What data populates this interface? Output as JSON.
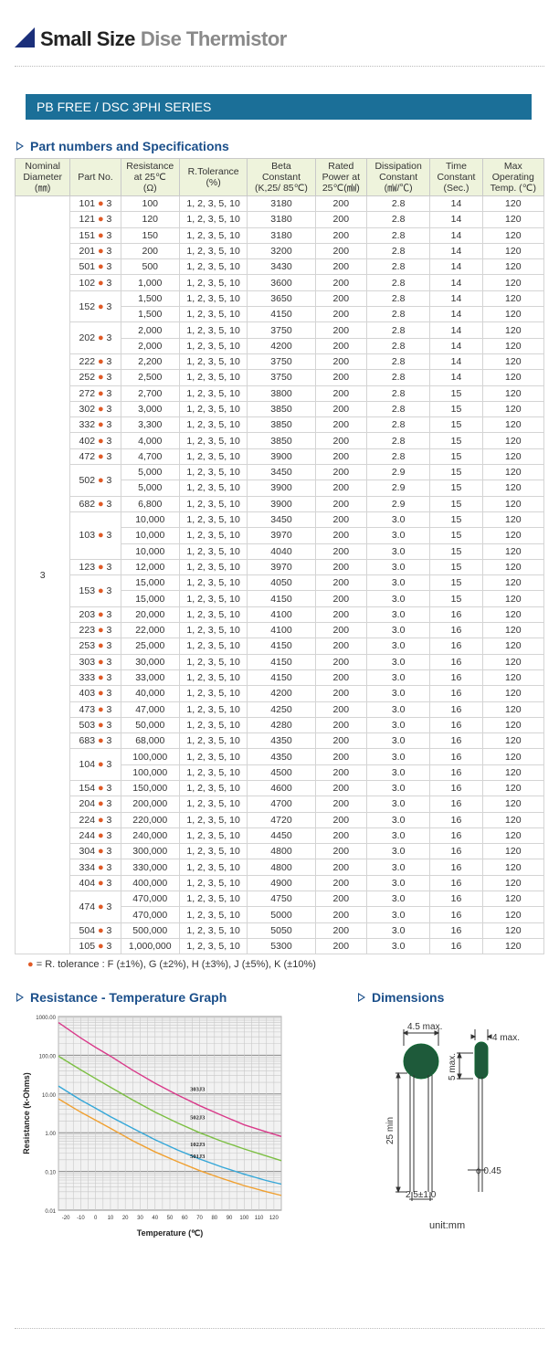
{
  "title": {
    "bold": "Small Size",
    "rest": "Dise Thermistor"
  },
  "series_label": "PB FREE  /  DSC 3PHI SERIES",
  "section_specs": "Part numbers and Specifications",
  "table": {
    "headers": [
      {
        "line1": "Nominal",
        "line2": "Diameter",
        "line3": "(㎜)"
      },
      {
        "line1": "Part No.",
        "line2": "",
        "line3": ""
      },
      {
        "line1": "Resistance",
        "line2": "at 25℃",
        "line3": "(Ω)"
      },
      {
        "line1": "R.Tolerance",
        "line2": "(%)",
        "line3": ""
      },
      {
        "line1": "Beta",
        "line2": "Constant",
        "line3": "(K,25/ 85℃)"
      },
      {
        "line1": "Rated",
        "line2": "Power at",
        "line3": "25℃(㎽)"
      },
      {
        "line1": "Dissipation",
        "line2": "Constant",
        "line3": "(㎽/℃)"
      },
      {
        "line1": "Time",
        "line2": "Constant",
        "line3": "(Sec.)"
      },
      {
        "line1": "Max",
        "line2": "Operating",
        "line3": "Temp. (℃)"
      }
    ],
    "diameter": "3",
    "dot": "●",
    "groups": [
      {
        "part": "101",
        "suffix": "3",
        "rows": [
          [
            "100",
            "1, 2, 3, 5, 10",
            "3180",
            "200",
            "2.8",
            "14",
            "120"
          ]
        ]
      },
      {
        "part": "121",
        "suffix": "3",
        "rows": [
          [
            "120",
            "1, 2, 3, 5, 10",
            "3180",
            "200",
            "2.8",
            "14",
            "120"
          ]
        ]
      },
      {
        "part": "151",
        "suffix": "3",
        "rows": [
          [
            "150",
            "1, 2, 3, 5, 10",
            "3180",
            "200",
            "2.8",
            "14",
            "120"
          ]
        ]
      },
      {
        "part": "201",
        "suffix": "3",
        "rows": [
          [
            "200",
            "1, 2, 3, 5, 10",
            "3200",
            "200",
            "2.8",
            "14",
            "120"
          ]
        ]
      },
      {
        "part": "501",
        "suffix": "3",
        "rows": [
          [
            "500",
            "1, 2, 3, 5, 10",
            "3430",
            "200",
            "2.8",
            "14",
            "120"
          ]
        ]
      },
      {
        "part": "102",
        "suffix": "3",
        "rows": [
          [
            "1,000",
            "1, 2, 3, 5, 10",
            "3600",
            "200",
            "2.8",
            "14",
            "120"
          ]
        ]
      },
      {
        "part": "152",
        "suffix": "3",
        "rows": [
          [
            "1,500",
            "1, 2, 3, 5, 10",
            "3650",
            "200",
            "2.8",
            "14",
            "120"
          ],
          [
            "1,500",
            "1, 2, 3, 5, 10",
            "4150",
            "200",
            "2.8",
            "14",
            "120"
          ]
        ]
      },
      {
        "part": "202",
        "suffix": "3",
        "rows": [
          [
            "2,000",
            "1, 2, 3, 5, 10",
            "3750",
            "200",
            "2.8",
            "14",
            "120"
          ],
          [
            "2,000",
            "1, 2, 3, 5, 10",
            "4200",
            "200",
            "2.8",
            "14",
            "120"
          ]
        ]
      },
      {
        "part": "222",
        "suffix": "3",
        "rows": [
          [
            "2,200",
            "1, 2, 3, 5, 10",
            "3750",
            "200",
            "2.8",
            "14",
            "120"
          ]
        ]
      },
      {
        "part": "252",
        "suffix": "3",
        "rows": [
          [
            "2,500",
            "1, 2, 3, 5, 10",
            "3750",
            "200",
            "2.8",
            "14",
            "120"
          ]
        ]
      },
      {
        "part": "272",
        "suffix": "3",
        "rows": [
          [
            "2,700",
            "1, 2, 3, 5, 10",
            "3800",
            "200",
            "2.8",
            "15",
            "120"
          ]
        ]
      },
      {
        "part": "302",
        "suffix": "3",
        "rows": [
          [
            "3,000",
            "1, 2, 3, 5, 10",
            "3850",
            "200",
            "2.8",
            "15",
            "120"
          ]
        ]
      },
      {
        "part": "332",
        "suffix": "3",
        "rows": [
          [
            "3,300",
            "1, 2, 3, 5, 10",
            "3850",
            "200",
            "2.8",
            "15",
            "120"
          ]
        ]
      },
      {
        "part": "402",
        "suffix": "3",
        "rows": [
          [
            "4,000",
            "1, 2, 3, 5, 10",
            "3850",
            "200",
            "2.8",
            "15",
            "120"
          ]
        ]
      },
      {
        "part": "472",
        "suffix": "3",
        "rows": [
          [
            "4,700",
            "1, 2, 3, 5, 10",
            "3900",
            "200",
            "2.8",
            "15",
            "120"
          ]
        ]
      },
      {
        "part": "502",
        "suffix": "3",
        "rows": [
          [
            "5,000",
            "1, 2, 3, 5, 10",
            "3450",
            "200",
            "2.9",
            "15",
            "120"
          ],
          [
            "5,000",
            "1, 2, 3, 5, 10",
            "3900",
            "200",
            "2.9",
            "15",
            "120"
          ]
        ]
      },
      {
        "part": "682",
        "suffix": "3",
        "rows": [
          [
            "6,800",
            "1, 2, 3, 5, 10",
            "3900",
            "200",
            "2.9",
            "15",
            "120"
          ]
        ]
      },
      {
        "part": "103",
        "suffix": "3",
        "rows": [
          [
            "10,000",
            "1, 2, 3, 5, 10",
            "3450",
            "200",
            "3.0",
            "15",
            "120"
          ],
          [
            "10,000",
            "1, 2, 3, 5, 10",
            "3970",
            "200",
            "3.0",
            "15",
            "120"
          ],
          [
            "10,000",
            "1, 2, 3, 5, 10",
            "4040",
            "200",
            "3.0",
            "15",
            "120"
          ]
        ]
      },
      {
        "part": "123",
        "suffix": "3",
        "rows": [
          [
            "12,000",
            "1, 2, 3, 5, 10",
            "3970",
            "200",
            "3.0",
            "15",
            "120"
          ]
        ]
      },
      {
        "part": "153",
        "suffix": "3",
        "rows": [
          [
            "15,000",
            "1, 2, 3, 5, 10",
            "4050",
            "200",
            "3.0",
            "15",
            "120"
          ],
          [
            "15,000",
            "1, 2, 3, 5, 10",
            "4150",
            "200",
            "3.0",
            "15",
            "120"
          ]
        ]
      },
      {
        "part": "203",
        "suffix": "3",
        "rows": [
          [
            "20,000",
            "1, 2, 3, 5, 10",
            "4100",
            "200",
            "3.0",
            "16",
            "120"
          ]
        ]
      },
      {
        "part": "223",
        "suffix": "3",
        "rows": [
          [
            "22,000",
            "1, 2, 3, 5, 10",
            "4100",
            "200",
            "3.0",
            "16",
            "120"
          ]
        ]
      },
      {
        "part": "253",
        "suffix": "3",
        "rows": [
          [
            "25,000",
            "1, 2, 3, 5, 10",
            "4150",
            "200",
            "3.0",
            "16",
            "120"
          ]
        ]
      },
      {
        "part": "303",
        "suffix": "3",
        "rows": [
          [
            "30,000",
            "1, 2, 3, 5, 10",
            "4150",
            "200",
            "3.0",
            "16",
            "120"
          ]
        ]
      },
      {
        "part": "333",
        "suffix": "3",
        "rows": [
          [
            "33,000",
            "1, 2, 3, 5, 10",
            "4150",
            "200",
            "3.0",
            "16",
            "120"
          ]
        ]
      },
      {
        "part": "403",
        "suffix": "3",
        "rows": [
          [
            "40,000",
            "1, 2, 3, 5, 10",
            "4200",
            "200",
            "3.0",
            "16",
            "120"
          ]
        ]
      },
      {
        "part": "473",
        "suffix": "3",
        "rows": [
          [
            "47,000",
            "1, 2, 3, 5, 10",
            "4250",
            "200",
            "3.0",
            "16",
            "120"
          ]
        ]
      },
      {
        "part": "503",
        "suffix": "3",
        "rows": [
          [
            "50,000",
            "1, 2, 3, 5, 10",
            "4280",
            "200",
            "3.0",
            "16",
            "120"
          ]
        ]
      },
      {
        "part": "683",
        "suffix": "3",
        "rows": [
          [
            "68,000",
            "1, 2, 3, 5, 10",
            "4350",
            "200",
            "3.0",
            "16",
            "120"
          ]
        ]
      },
      {
        "part": "104",
        "suffix": "3",
        "rows": [
          [
            "100,000",
            "1, 2, 3, 5, 10",
            "4350",
            "200",
            "3.0",
            "16",
            "120"
          ],
          [
            "100,000",
            "1, 2, 3, 5, 10",
            "4500",
            "200",
            "3.0",
            "16",
            "120"
          ]
        ]
      },
      {
        "part": "154",
        "suffix": "3",
        "rows": [
          [
            "150,000",
            "1, 2, 3, 5, 10",
            "4600",
            "200",
            "3.0",
            "16",
            "120"
          ]
        ]
      },
      {
        "part": "204",
        "suffix": "3",
        "rows": [
          [
            "200,000",
            "1, 2, 3, 5, 10",
            "4700",
            "200",
            "3.0",
            "16",
            "120"
          ]
        ]
      },
      {
        "part": "224",
        "suffix": "3",
        "rows": [
          [
            "220,000",
            "1, 2, 3, 5, 10",
            "4720",
            "200",
            "3.0",
            "16",
            "120"
          ]
        ]
      },
      {
        "part": "244",
        "suffix": "3",
        "rows": [
          [
            "240,000",
            "1, 2, 3, 5, 10",
            "4450",
            "200",
            "3.0",
            "16",
            "120"
          ]
        ]
      },
      {
        "part": "304",
        "suffix": "3",
        "rows": [
          [
            "300,000",
            "1, 2, 3, 5, 10",
            "4800",
            "200",
            "3.0",
            "16",
            "120"
          ]
        ]
      },
      {
        "part": "334",
        "suffix": "3",
        "rows": [
          [
            "330,000",
            "1, 2, 3, 5, 10",
            "4800",
            "200",
            "3.0",
            "16",
            "120"
          ]
        ]
      },
      {
        "part": "404",
        "suffix": "3",
        "rows": [
          [
            "400,000",
            "1, 2, 3, 5, 10",
            "4900",
            "200",
            "3.0",
            "16",
            "120"
          ]
        ]
      },
      {
        "part": "474",
        "suffix": "3",
        "rows": [
          [
            "470,000",
            "1, 2, 3, 5, 10",
            "4750",
            "200",
            "3.0",
            "16",
            "120"
          ],
          [
            "470,000",
            "1, 2, 3, 5, 10",
            "5000",
            "200",
            "3.0",
            "16",
            "120"
          ]
        ]
      },
      {
        "part": "504",
        "suffix": "3",
        "rows": [
          [
            "500,000",
            "1, 2, 3, 5, 10",
            "5050",
            "200",
            "3.0",
            "16",
            "120"
          ]
        ]
      },
      {
        "part": "105",
        "suffix": "3",
        "rows": [
          [
            "1,000,000",
            "1, 2, 3, 5, 10",
            "5300",
            "200",
            "3.0",
            "16",
            "120"
          ]
        ]
      }
    ]
  },
  "tolerance_note": "= R. tolerance : F (±1%), G (±2%), H (±3%), J (±5%), K (±10%)",
  "section_graph": "Resistance - Temperature Graph",
  "section_dims": "Dimensions",
  "chart_data": {
    "type": "line",
    "xlabel": "Temperature (℃)",
    "ylabel": "Resistance (k-Ohms)",
    "xticks": [
      "-20",
      "-10",
      "0",
      "10",
      "20",
      "30",
      "40",
      "50",
      "60",
      "70",
      "80",
      "90",
      "100",
      "110",
      "120"
    ],
    "yticks": [
      "1000.00",
      "100.00",
      "10.00",
      "1.00",
      "0.10",
      "0.01"
    ],
    "ylim": [
      0.01,
      1000
    ],
    "xlim": [
      -25,
      125
    ],
    "yscale": "log",
    "grid": true,
    "series": [
      {
        "name": "303J3",
        "color": "#d93a8a",
        "x": [
          -25,
          -10,
          0,
          10,
          25,
          40,
          55,
          70,
          85,
          100,
          115,
          125
        ],
        "values": [
          700,
          280,
          160,
          95,
          41,
          19,
          9.5,
          5,
          2.8,
          1.6,
          1.05,
          0.8
        ]
      },
      {
        "name": "502J3",
        "color": "#7cbf43",
        "x": [
          -25,
          -10,
          0,
          10,
          25,
          40,
          55,
          70,
          85,
          100,
          115,
          125
        ],
        "values": [
          95,
          42,
          25,
          15,
          7,
          3.4,
          1.8,
          1.0,
          0.6,
          0.38,
          0.25,
          0.19
        ]
      },
      {
        "name": "102J3",
        "color": "#35a7d8",
        "x": [
          -25,
          -10,
          0,
          10,
          25,
          40,
          55,
          70,
          85,
          100,
          115,
          125
        ],
        "values": [
          16,
          7,
          4.3,
          2.6,
          1.3,
          0.66,
          0.36,
          0.21,
          0.13,
          0.085,
          0.058,
          0.047
        ]
      },
      {
        "name": "501J3",
        "color": "#f0a030",
        "x": [
          -25,
          -10,
          0,
          10,
          25,
          40,
          55,
          70,
          85,
          100,
          115,
          125
        ],
        "values": [
          7.5,
          3.4,
          2.1,
          1.3,
          0.62,
          0.32,
          0.18,
          0.105,
          0.066,
          0.043,
          0.03,
          0.024
        ]
      }
    ]
  },
  "dimensions": {
    "diameter": "4.5 max.",
    "thickness": "4 max.",
    "coating": "5 max.",
    "lead_length": "25 min",
    "pitch": "2.5±1.0",
    "lead_dia": "ϕ 0.45",
    "unit": "unit:mm"
  }
}
